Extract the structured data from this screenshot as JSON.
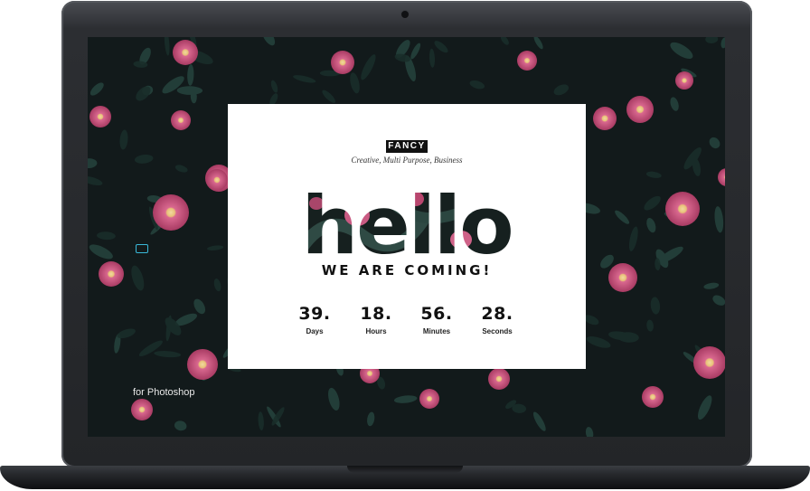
{
  "card": {
    "badge": "FANCY",
    "tagline": "Creative, Multi Purpose, Business",
    "headline": "hello",
    "subheadline": "WE ARE COMING!"
  },
  "countdown": [
    {
      "value": "39.",
      "label": "Days"
    },
    {
      "value": "18.",
      "label": "Hours"
    },
    {
      "value": "56.",
      "label": "Minutes"
    },
    {
      "value": "28.",
      "label": "Seconds"
    }
  ],
  "footer_text": "for Photoshop",
  "colors": {
    "bezel": "#232528",
    "screen_bg": "#13191a",
    "leaf": "#1f3330",
    "flower": "#c94f7a",
    "card_bg": "#ffffff",
    "text": "#111111",
    "icon_accent": "#39b8d8"
  }
}
